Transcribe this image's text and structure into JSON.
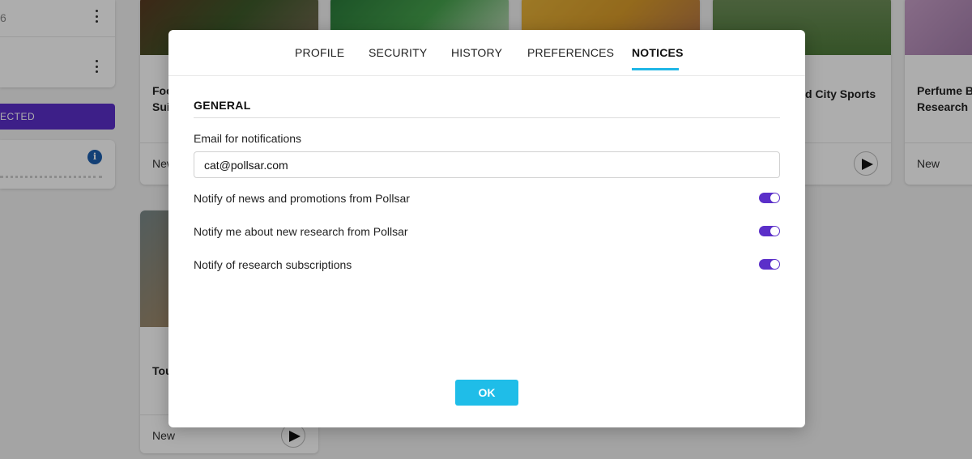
{
  "background": {
    "left_panel": {
      "row1_value": "6"
    },
    "selected_label": "ECTED",
    "cards": [
      {
        "title": "Foc\nSui",
        "status": "New"
      },
      {
        "title": "",
        "status": ""
      },
      {
        "title": "",
        "status": ""
      },
      {
        "title": "d City Sports",
        "status": ""
      },
      {
        "title": "Perfume Br\nResearch",
        "status": "New"
      },
      {
        "title": "Tou",
        "status": "New"
      }
    ]
  },
  "modal": {
    "tabs": [
      {
        "label": "PROFILE",
        "active": false
      },
      {
        "label": "SECURITY",
        "active": false
      },
      {
        "label": "HISTORY",
        "active": false
      },
      {
        "label": "PREFERENCES",
        "active": false
      },
      {
        "label": "NOTICES",
        "active": true
      }
    ],
    "section_title": "GENERAL",
    "email_label": "Email for notifications",
    "email_value": "cat@pollsar.com",
    "notifications": [
      {
        "label": "Notify of news and promotions from Pollsar",
        "enabled": true
      },
      {
        "label": "Notify me about new research from Pollsar",
        "enabled": true
      },
      {
        "label": "Notify of research subscriptions",
        "enabled": true
      }
    ],
    "ok_label": "OK"
  },
  "colors": {
    "accent": "#1fb6e6",
    "toggle_on": "#5b2fc9",
    "selected_bar": "#5b2fc9",
    "info_icon": "#1d5fae"
  }
}
